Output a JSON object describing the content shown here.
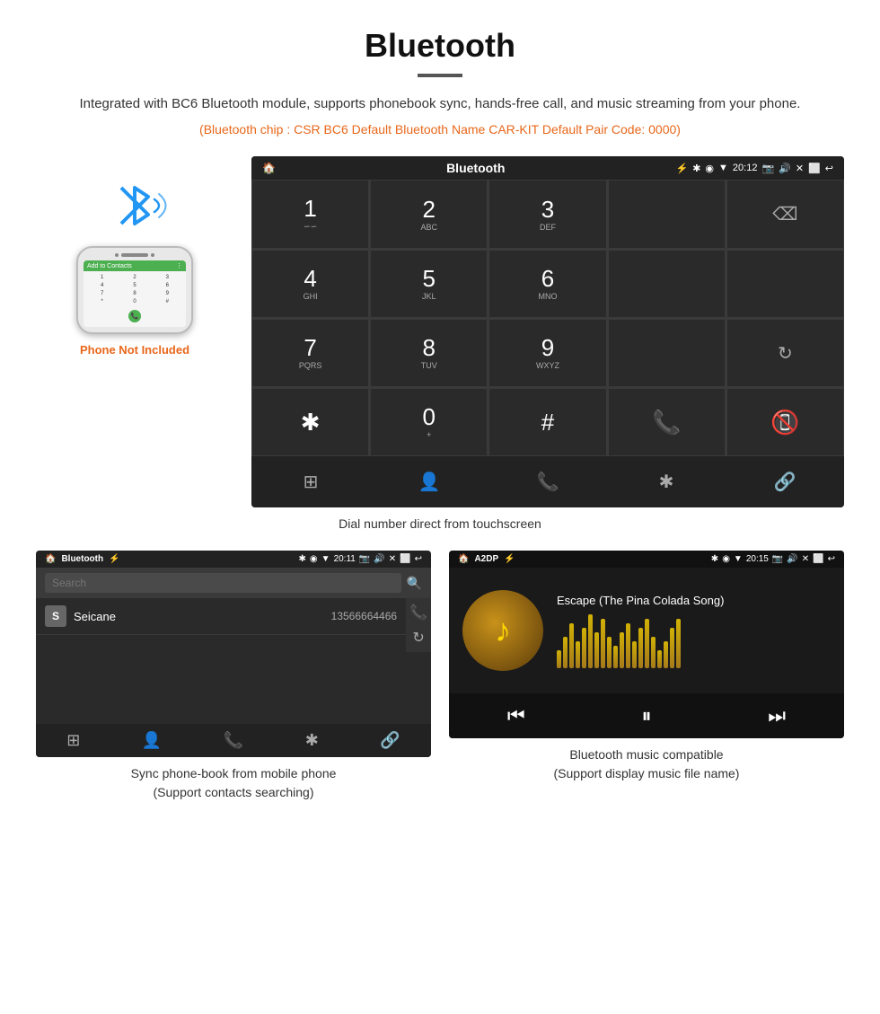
{
  "page": {
    "title": "Bluetooth",
    "divider": true,
    "description": "Integrated with BC6 Bluetooth module, supports phonebook sync, hands-free call, and music streaming from your phone.",
    "specs": "(Bluetooth chip : CSR BC6    Default Bluetooth Name CAR-KIT    Default Pair Code: 0000)"
  },
  "dialpad_screen": {
    "statusbar": {
      "left": "🏠",
      "center": "Bluetooth",
      "usb_icon": "⚡",
      "right_icons": "✱ ◉ ▼ 20:12",
      "camera": "📷",
      "volume": "🔊",
      "close": "✕",
      "window": "⬜",
      "back": "↩"
    },
    "keys": [
      {
        "num": "1",
        "sub": "∽∽"
      },
      {
        "num": "2",
        "sub": "ABC"
      },
      {
        "num": "3",
        "sub": "DEF"
      },
      {
        "num": "",
        "sub": ""
      },
      {
        "num": "⌫",
        "sub": ""
      },
      {
        "num": "4",
        "sub": "GHI"
      },
      {
        "num": "5",
        "sub": "JKL"
      },
      {
        "num": "6",
        "sub": "MNO"
      },
      {
        "num": "",
        "sub": ""
      },
      {
        "num": "",
        "sub": ""
      },
      {
        "num": "7",
        "sub": "PQRS"
      },
      {
        "num": "8",
        "sub": "TUV"
      },
      {
        "num": "9",
        "sub": "WXYZ"
      },
      {
        "num": "",
        "sub": ""
      },
      {
        "num": "↻",
        "sub": ""
      },
      {
        "num": "✱",
        "sub": ""
      },
      {
        "num": "0",
        "sub": "+"
      },
      {
        "num": "#",
        "sub": ""
      },
      {
        "num": "📞",
        "sub": "green"
      },
      {
        "num": "📞",
        "sub": "red"
      }
    ],
    "bottom_bar": [
      "⊞",
      "👤",
      "📞",
      "✱",
      "🔗"
    ]
  },
  "phone_mockup": {
    "keys": [
      "1",
      "2",
      "3",
      "4",
      "5",
      "6",
      "7",
      "8",
      "9",
      "*",
      "0",
      "#"
    ],
    "label": "Add to Contacts"
  },
  "phone_not_included": "Phone Not Included",
  "dialpad_caption": "Dial number direct from touchscreen",
  "phonebook_screen": {
    "statusbar_left": "🏠  Bluetooth  ⚡",
    "statusbar_right": "✱ ◉ ▼ 20:11  📷  🔊  ✕  ⬜  ↩",
    "search_placeholder": "Search",
    "contacts": [
      {
        "letter": "S",
        "name": "Seicane",
        "number": "13566664466"
      }
    ],
    "right_icons": [
      "📞",
      "↻"
    ],
    "bottom_icons": [
      "⊞",
      "👤",
      "📞",
      "✱",
      "🔗"
    ]
  },
  "phonebook_caption": "Sync phone-book from mobile phone\n(Support contacts searching)",
  "music_screen": {
    "statusbar_left": "🏠  A2DP  ⚡",
    "statusbar_right": "✱ ◉ ▼ 20:15  📷  🔊  ✕  ⬜  ↩",
    "song_title": "Escape (The Pina Colada Song)",
    "controls": [
      "⏮",
      "⏸",
      "⏭"
    ],
    "visualizer_bars": [
      20,
      35,
      50,
      30,
      45,
      60,
      40,
      55,
      35,
      25,
      40,
      50,
      30,
      45,
      55,
      35,
      20,
      30,
      45,
      55
    ]
  },
  "music_caption": "Bluetooth music compatible\n(Support display music file name)",
  "watermark": "Seicane"
}
